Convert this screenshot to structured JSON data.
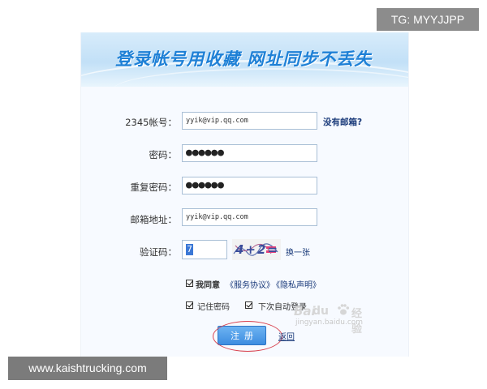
{
  "watermark_tag": "TG: MYYJJPP",
  "watermark_site": "www.kaishtrucking.com",
  "banner": {
    "title": "登录帐号用收藏 网址同步不丢失"
  },
  "form": {
    "account_label": "2345帐号：",
    "account_value": "yyik@vip.qq.com",
    "no_email_link": "没有邮箱?",
    "password_label": "密码：",
    "password_value": "●●●●●●",
    "repeat_password_label": "重复密码：",
    "repeat_password_value": "●●●●●●",
    "email_label": "邮箱地址：",
    "email_value": "yyik@vip.qq.com",
    "captcha_label": "验证码：",
    "captcha_value": "7",
    "captcha_image_text": "4+2=",
    "refresh_link": "换一张",
    "agree_text": "我同意",
    "service_link": "《服务协议》",
    "privacy_link": "《隐私声明》",
    "remember_password": "记住密码",
    "auto_login": "下次自动登录",
    "register_button": "注册",
    "back_link": "返回"
  },
  "baidu_watermark": {
    "b1": "Bai",
    "b2": "du",
    "b3": "经验",
    "url": "jingyan.baidu.com"
  },
  "colors": {
    "accent": "#3d8de0",
    "banner_text": "#1e80d6",
    "highlight_ring": "#d8424f"
  }
}
